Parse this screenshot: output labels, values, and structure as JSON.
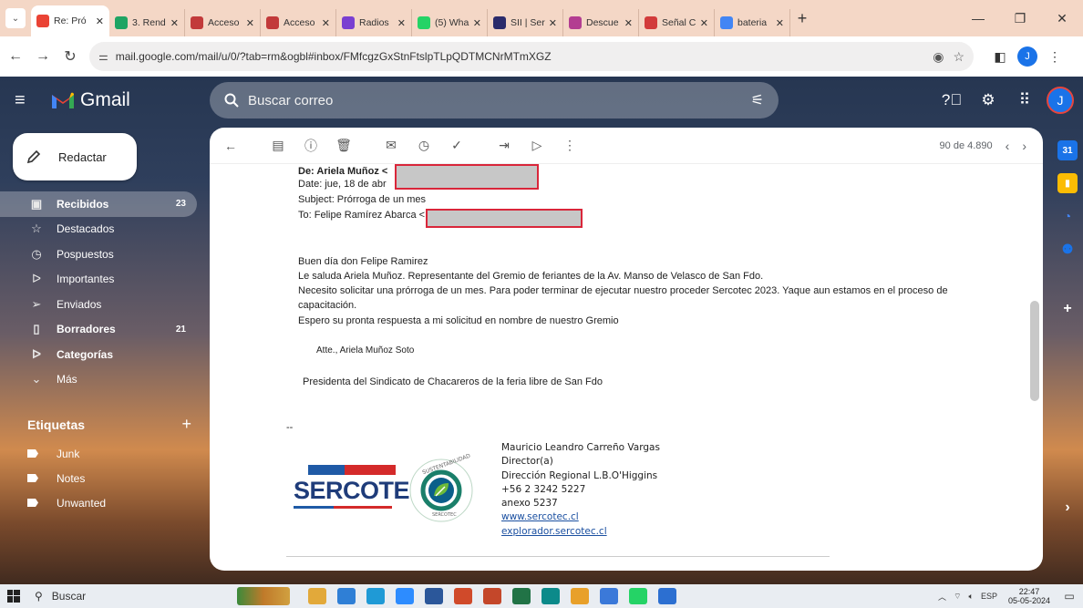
{
  "browser": {
    "tabs": [
      {
        "title": "Re: Pró",
        "favicon": "gmail-icon",
        "color": "#ea4335",
        "active": true
      },
      {
        "title": "3. Rend",
        "favicon": "google-drive-icon",
        "color": "#1fa463"
      },
      {
        "title": "Acceso",
        "favicon": "access-icon",
        "color": "#c23a3a"
      },
      {
        "title": "Acceso",
        "favicon": "access-icon",
        "color": "#c23a3a"
      },
      {
        "title": "Radios",
        "favicon": "radio-icon",
        "color": "#7a3fd1"
      },
      {
        "title": "(5) Wha",
        "favicon": "whatsapp-icon",
        "color": "#25d366"
      },
      {
        "title": "SII | Ser",
        "favicon": "sii-icon",
        "color": "#2b2b6b"
      },
      {
        "title": "Descue",
        "favicon": "discount-icon",
        "color": "#b33d91"
      },
      {
        "title": "Señal C",
        "favicon": "signal-icon",
        "color": "#d23b3b"
      },
      {
        "title": "bateria",
        "favicon": "google-icon",
        "color": "#4285f4"
      }
    ],
    "new_tab_label": "+",
    "url": "mail.google.com/mail/u/0/?tab=rm&ogbl#inbox/FMfcgzGxStnFtslpTLpQDTMCNrMTmXGZ",
    "profile_initial": "J"
  },
  "gmail": {
    "brand": "Gmail",
    "search_placeholder": "Buscar correo",
    "avatar_initial": "J",
    "compose_label": "Redactar",
    "nav": [
      {
        "label": "Recibidos",
        "count": "23",
        "icon": "inbox-icon",
        "glyph": "▣",
        "selected": true,
        "bold": true
      },
      {
        "label": "Destacados",
        "count": "",
        "icon": "star-icon",
        "glyph": "☆"
      },
      {
        "label": "Pospuestos",
        "count": "",
        "icon": "clock-icon",
        "glyph": "◷"
      },
      {
        "label": "Importantes",
        "count": "",
        "icon": "important-icon",
        "glyph": "ᐅ"
      },
      {
        "label": "Enviados",
        "count": "",
        "icon": "send-icon",
        "glyph": "➢"
      },
      {
        "label": "Borradores",
        "count": "21",
        "icon": "draft-icon",
        "glyph": "▯",
        "bold": true
      },
      {
        "label": "Categorías",
        "count": "",
        "icon": "label-icon",
        "glyph": "ᐅ",
        "bold": true
      },
      {
        "label": "Más",
        "count": "",
        "icon": "chevron-down-icon",
        "glyph": "⌄"
      }
    ],
    "labels_heading": "Etiquetas",
    "labels": [
      "Junk",
      "Notes",
      "Unwanted"
    ],
    "pager_text": "90 de 4.890"
  },
  "message": {
    "from_line": "De: Ariela Muñoz <",
    "date_line": "Date: jue, 18 de abr",
    "subject_line": "Subject: Prórroga de un mes",
    "to_line": "To: Felipe Ramírez Abarca <",
    "greeting": "Buen día don Felipe Ramirez",
    "body1": "Le saluda Ariela Muñoz.  Representante del Gremio de feriantes de  la Av. Manso de Velasco de San Fdo.",
    "body2": "Necesito solicitar una prórroga de un mes. Para poder terminar de ejecutar nuestro proceder Sercotec 2023. Yaque aun estamos en el proceso de",
    "body3": "capacitación.",
    "body4": "Espero su pronta respuesta a mi solicitud en nombre de nuestro Gremio",
    "closing": "Atte., Ariela Muñoz Soto",
    "org": "Presidenta del Sindicato de Chacareros de la feria libre de San Fdo",
    "separator": "--"
  },
  "signature": {
    "name": "Mauricio Leandro Carreño Vargas",
    "role": "Director(a)",
    "office": "Dirección Regional L.B.O'Higgins",
    "phone": "+56 2 3242 5227",
    "ext": "anexo 5237",
    "link1": "www.sercotec.cl",
    "link2": "explorador.sercotec.cl",
    "logo_text": "SERCOTEC",
    "badge_top": "SUSTENTABILIDAD",
    "badge_bottom": "SERCOTEC"
  },
  "taskbar": {
    "search_label": "Buscar",
    "lang": "ESP",
    "time": "22:47",
    "date": "05-05-2024",
    "apps": [
      {
        "name": "file-explorer-icon",
        "color": "#e2a93a"
      },
      {
        "name": "store-icon",
        "color": "#2f7fd6"
      },
      {
        "name": "edge-icon",
        "color": "#1f9ad6"
      },
      {
        "name": "zoom-icon",
        "color": "#2d8cff"
      },
      {
        "name": "word-icon",
        "color": "#2b579a"
      },
      {
        "name": "pdf-icon",
        "color": "#d04a2a"
      },
      {
        "name": "powerpoint-icon",
        "color": "#c4472a"
      },
      {
        "name": "excel-icon",
        "color": "#217346"
      },
      {
        "name": "edge-browser-icon",
        "color": "#0c8a8a"
      },
      {
        "name": "chrome-icon",
        "color": "#e8a02a"
      },
      {
        "name": "chrome-alt-icon",
        "color": "#3b79d9"
      },
      {
        "name": "whatsapp-icon",
        "color": "#25d366"
      },
      {
        "name": "photos-icon",
        "color": "#2c6fd1"
      }
    ]
  }
}
